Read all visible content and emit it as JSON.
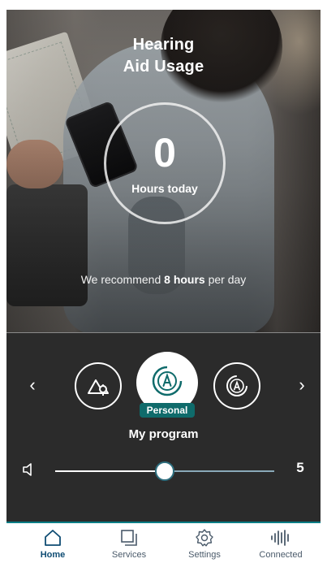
{
  "hero": {
    "title_line1": "Hearing",
    "title_line2": "Aid Usage",
    "hours_value": "0",
    "hours_label": "Hours today",
    "recommend_prefix": "We recommend",
    "recommend_bold": "8 hours",
    "recommend_suffix": "per day"
  },
  "program": {
    "prev_label": "‹",
    "next_label": "›",
    "active_badge": "Personal",
    "name": "My program"
  },
  "volume": {
    "value": "5",
    "level_fraction": 0.5
  },
  "nav": {
    "items": [
      {
        "label": "Home",
        "icon": "home-icon",
        "active": true
      },
      {
        "label": "Services",
        "icon": "services-icon",
        "active": false
      },
      {
        "label": "Settings",
        "icon": "settings-icon",
        "active": false
      },
      {
        "label": "Connected",
        "icon": "connected-icon",
        "active": false
      }
    ]
  },
  "colors": {
    "panel_bg": "#2b2b2b",
    "accent_teal": "#0f6b6b",
    "nav_active": "#0e4c73"
  }
}
